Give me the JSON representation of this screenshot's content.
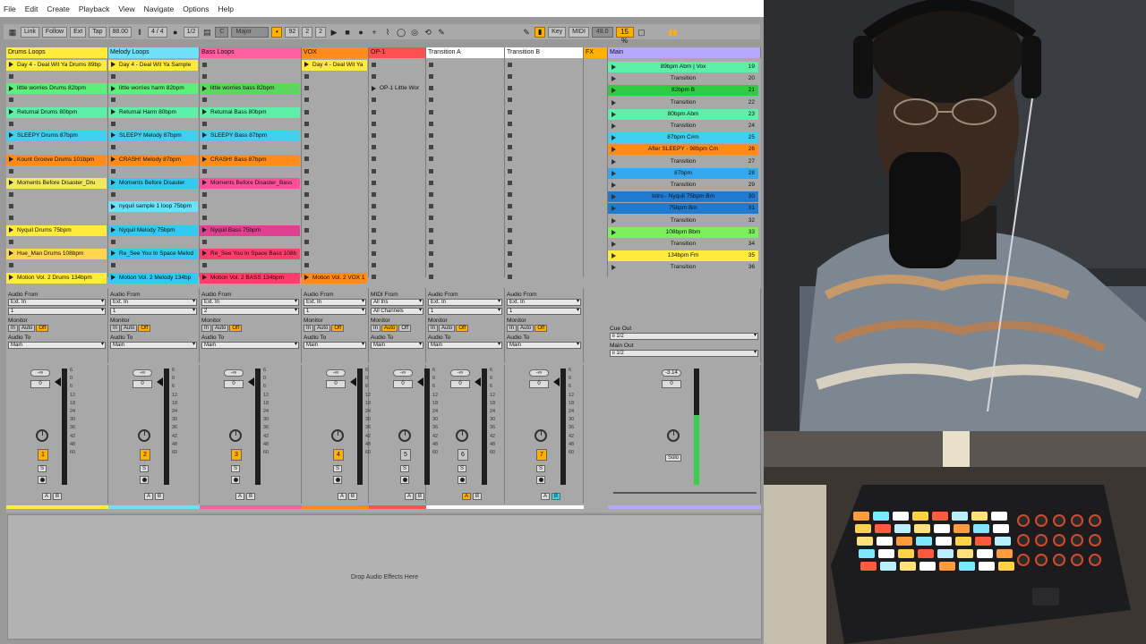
{
  "menu": [
    "File",
    "Edit",
    "Create",
    "Playback",
    "View",
    "Navigate",
    "Options",
    "Help"
  ],
  "toolbar": {
    "link": "Link",
    "follow": "Follow",
    "ext": "Ext",
    "tap": "Tap",
    "tempo": "88.00",
    "sig": "4 / 4",
    "quant": "1/2",
    "key": "C",
    "scale": "Major",
    "pos1": "92",
    "pos2": "2",
    "pos3": "2",
    "key_btn": "Key",
    "midi_btn": "MIDI",
    "sample_rate": "48.0",
    "cpu": "15 %"
  },
  "tracks": [
    {
      "name": "Drums Loops",
      "color": "#ffeb3b",
      "clips": [
        [
          "Day 4 - Deal Wit Ya Drums 89bp",
          "#ffeb3b"
        ],
        [
          "little worries Drums 82bpm",
          "#5cf07a"
        ],
        [
          "Returnal Drums 80bpm",
          "#5cf0a8"
        ],
        [
          "SLEEPY Drums 87bpm",
          "#3fd0f0"
        ],
        [
          "Kount Groove Drums 101bpm",
          "#ff8c1a"
        ],
        [
          "Moments Before Disaster_Dru",
          "#f2e85c"
        ],
        [
          "",
          ""
        ],
        [
          "Nyquil Drums 75bpm",
          "#ffeb3b"
        ],
        [
          "Hue_Man Drums 108bpm",
          "#ffd54f"
        ],
        [
          "Motion Vol. 2 Drums 134bpm",
          "#ffeb3b"
        ]
      ]
    },
    {
      "name": "Melody Loops",
      "color": "#6ee0f7",
      "clips": [
        [
          "Day 4 - Deal Wit Ya Sample",
          "#ffeb3b"
        ],
        [
          "little worries harm 82bpm",
          "#5cf07a"
        ],
        [
          "Returnal Harm 80bpm",
          "#5cf0a8"
        ],
        [
          "SLEEPY Melody 87bpm",
          "#3fd0f0"
        ],
        [
          "CRASH! Melody 87bpm",
          "#ff8c1a"
        ],
        [
          "Moments Before Disaster",
          "#33c9f0"
        ],
        [
          "nyquil sample 1 loop 75bpm",
          "#6ee0f7"
        ],
        [
          "Nyquil Melody 75bpm",
          "#33c9f0"
        ],
        [
          "Re_See You In Space Melod",
          "#33c9f0"
        ],
        [
          "Motion Vol. 2 Melody 134bp",
          "#33c9f0"
        ]
      ]
    },
    {
      "name": "Bass Loops",
      "color": "#ff5fa0",
      "clips": [
        [
          "",
          ""
        ],
        [
          "little worries bass 82bpm",
          "#5cd65c"
        ],
        [
          "Returnal Bass 80bpm",
          "#5cf0a8"
        ],
        [
          "SLEEPY Bass 87bpm",
          "#3fd0f0"
        ],
        [
          "CRASH! Bass 87bpm",
          "#ff8c1a"
        ],
        [
          "Moments Before Disaster_Bass",
          "#ff4f9a"
        ],
        [
          "",
          ""
        ],
        [
          "Nyquil Bass 75bpm",
          "#e04090"
        ],
        [
          "Re_See You In Space Bass 108b",
          "#ff3d6a"
        ],
        [
          "Motion Vol. 2 BASS 134bpm",
          "#ff3d6a"
        ]
      ]
    },
    {
      "name": "VOX",
      "color": "#ff8c1a",
      "clips": [
        [
          "Day 4 - Deal Wit Ya",
          "#ffeb3b"
        ],
        [
          "",
          ""
        ],
        [
          "",
          ""
        ],
        [
          "",
          ""
        ],
        [
          "",
          ""
        ],
        [
          "",
          ""
        ],
        [
          "",
          ""
        ],
        [
          "",
          ""
        ],
        [
          "",
          ""
        ],
        [
          "Motion Vol. 2 VOX 1",
          "#ff8c1a"
        ]
      ]
    },
    {
      "name": "OP-1",
      "color": "#ff5050",
      "clips": [
        [
          "",
          ""
        ],
        [
          "OP-1 Little Wor",
          "#a8a8a8"
        ],
        [
          "",
          ""
        ],
        [
          "",
          ""
        ],
        [
          "",
          ""
        ],
        [
          "",
          ""
        ],
        [
          "",
          ""
        ],
        [
          "",
          ""
        ],
        [
          "",
          ""
        ],
        [
          "",
          ""
        ]
      ]
    },
    {
      "name": "Transition A",
      "color": "#ffffff",
      "clips": [
        [
          "",
          ""
        ],
        [
          "",
          ""
        ],
        [
          "",
          ""
        ],
        [
          "",
          ""
        ],
        [
          "",
          ""
        ],
        [
          "",
          ""
        ],
        [
          "",
          ""
        ],
        [
          "",
          ""
        ],
        [
          "",
          ""
        ],
        [
          "",
          ""
        ]
      ]
    },
    {
      "name": "Transition B",
      "color": "#ffffff",
      "clips": [
        [
          "",
          ""
        ],
        [
          "",
          ""
        ],
        [
          "",
          ""
        ],
        [
          "",
          ""
        ],
        [
          "",
          ""
        ],
        [
          "",
          ""
        ],
        [
          "",
          ""
        ],
        [
          "",
          ""
        ],
        [
          "",
          ""
        ],
        [
          "",
          ""
        ]
      ]
    },
    {
      "name": "FX",
      "color": "#ffb000",
      "clips": []
    }
  ],
  "io": [
    {
      "type": "Audio From",
      "src": "Ext. In",
      "ch": "1",
      "monitor": "Monitor",
      "to_lbl": "Audio To",
      "to": "Main"
    },
    {
      "type": "Audio From",
      "src": "Ext. In",
      "ch": "1",
      "monitor": "Monitor",
      "to_lbl": "Audio To",
      "to": "Main"
    },
    {
      "type": "Audio From",
      "src": "Ext. In",
      "ch": "2",
      "monitor": "Monitor",
      "to_lbl": "Audio To",
      "to": "Main"
    },
    {
      "type": "Audio From",
      "src": "Ext. In",
      "ch": "1",
      "monitor": "Monitor",
      "to_lbl": "Audio To",
      "to": "Main"
    },
    {
      "type": "MIDI From",
      "src": "All Ins",
      "ch": "All Channels",
      "monitor": "Monitor",
      "to_lbl": "Audio To",
      "to": "Main"
    },
    {
      "type": "Audio From",
      "src": "Ext. In",
      "ch": "1",
      "monitor": "Monitor",
      "to_lbl": "Audio To",
      "to": "Main"
    },
    {
      "type": "Audio From",
      "src": "Ext. In",
      "ch": "1",
      "monitor": "Monitor",
      "to_lbl": "Audio To",
      "to": "Main"
    }
  ],
  "mon_labels": [
    "In",
    "Auto",
    "Off"
  ],
  "mixer": {
    "send": "-∞",
    "vol": "0",
    "numbers": [
      "1",
      "2",
      "3",
      "4",
      "5",
      "6",
      "7"
    ],
    "solo": "S",
    "a": "A",
    "b": "B",
    "scale": [
      "6",
      "0",
      "6",
      "12",
      "18",
      "24",
      "30",
      "36",
      "42",
      "48",
      "60"
    ]
  },
  "main": {
    "name": "Main",
    "cue_out_lbl": "Cue Out",
    "cue_out": "ii 1/2",
    "main_out_lbl": "Main Out",
    "main_out": "ii 1/2",
    "send": "-3.14",
    "vol": "0",
    "solo": "Solo"
  },
  "scenes": [
    [
      "89bpm Abm | Vox",
      "19",
      "#5cf0a8"
    ],
    [
      "Transition",
      "20",
      ""
    ],
    [
      "82bpm B",
      "21",
      "#2ecc40"
    ],
    [
      "Transition",
      "22",
      ""
    ],
    [
      "80bpm Abm",
      "23",
      "#5cf0a8"
    ],
    [
      "Transition",
      "24",
      ""
    ],
    [
      "87bpm C#m",
      "25",
      "#3fd0f0"
    ],
    [
      "After SLEEPY - 98bpm Cm",
      "26",
      "#ff8c1a"
    ],
    [
      "Transition",
      "27",
      ""
    ],
    [
      "87bpm",
      "28",
      "#33a8f0"
    ],
    [
      "Transition",
      "29",
      ""
    ],
    [
      "Intro - Nyquil 75bpm Bm",
      "30",
      "#1f7ad0"
    ],
    [
      "75bpm Bm",
      "31",
      "#1f7ad0"
    ],
    [
      "Transition",
      "32",
      ""
    ],
    [
      "108bpm Bbm",
      "33",
      "#7bf05a"
    ],
    [
      "Transition",
      "34",
      ""
    ],
    [
      "134bpm Fm",
      "35",
      "#ffeb3b"
    ],
    [
      "Transition",
      "36",
      ""
    ]
  ],
  "fx_drop": "Drop Audio Effects Here",
  "colors": {
    "accent": "#ffb000"
  }
}
